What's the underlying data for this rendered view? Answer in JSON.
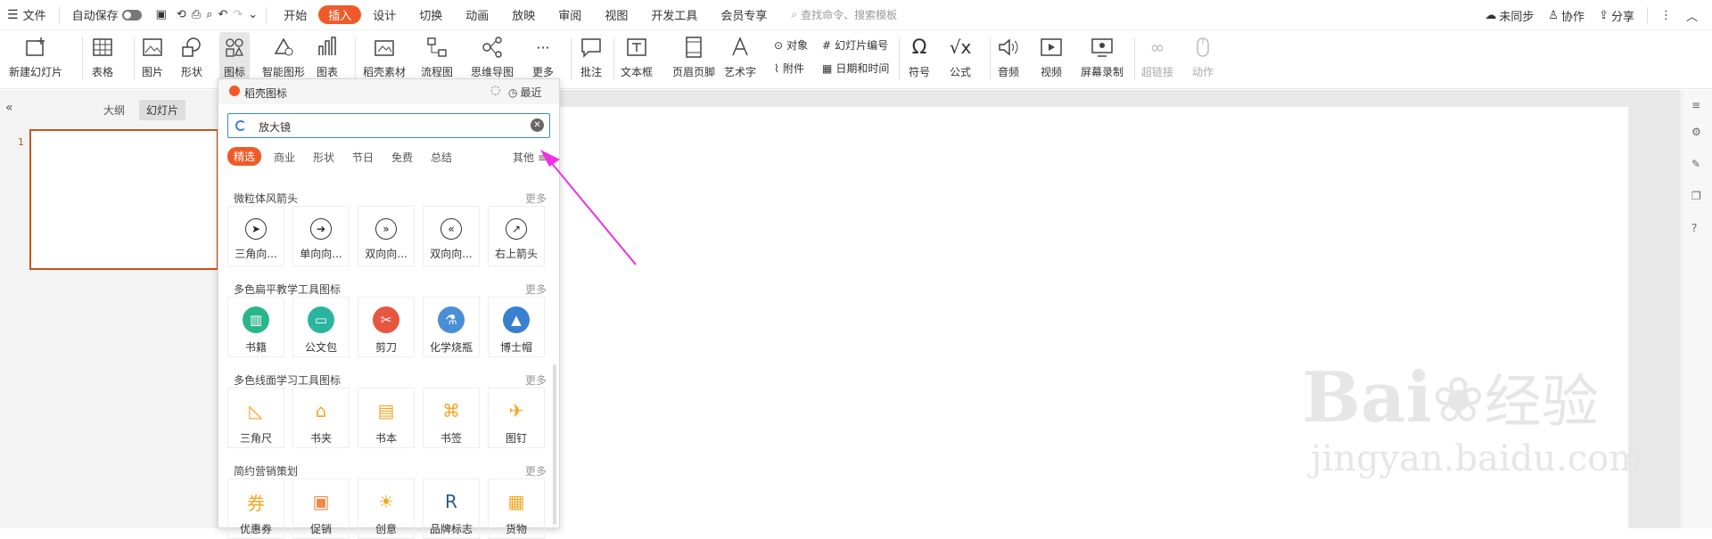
{
  "menubar": {
    "file": "文件",
    "autosave": "自动保存",
    "tabs": [
      "开始",
      "插入",
      "设计",
      "切换",
      "动画",
      "放映",
      "审阅",
      "视图",
      "开发工具",
      "会员专享"
    ],
    "search_placeholder": "查找命令、搜索模板",
    "unsynced": "未同步",
    "collab": "协作",
    "share": "分享"
  },
  "ribbon": {
    "new_slide": "新建幻灯片",
    "table": "表格",
    "picture": "图片",
    "shape": "形状",
    "icon": "图标",
    "smart": "智能图形",
    "chart": "图表",
    "material": "稻壳素材",
    "flow": "流程图",
    "mind": "思维导图",
    "more": "更多",
    "comment": "批注",
    "textbox": "文本框",
    "header": "页眉页脚",
    "art": "艺术字",
    "object": "对象",
    "slideno": "幻灯片编号",
    "attach": "附件",
    "datetime": "日期和时间",
    "symbol": "符号",
    "formula": "公式",
    "audio": "音频",
    "video": "视频",
    "screenrec": "屏幕录制",
    "hyperlink": "超链接",
    "action": "动作"
  },
  "leftpane": {
    "outline": "大纲",
    "slides": "幻灯片",
    "slide_number": "1"
  },
  "panel": {
    "title": "稻壳图标",
    "recent": "最近",
    "search_value": "放大镜",
    "categories": [
      "精选",
      "商业",
      "形状",
      "节日",
      "免费",
      "总结"
    ],
    "other": "其他",
    "more": "更多",
    "sections": [
      {
        "title": "微粒体风箭头",
        "items": [
          {
            "label": "三角向...",
            "glyph": "➤"
          },
          {
            "label": "单向向...",
            "glyph": "➔"
          },
          {
            "label": "双向向...",
            "glyph": "»"
          },
          {
            "label": "双向向...",
            "glyph": "«"
          },
          {
            "label": "右上箭头",
            "glyph": "↗"
          }
        ]
      },
      {
        "title": "多色扁平教学工具图标",
        "items": [
          {
            "label": "书籍",
            "glyph": "▥",
            "color": "#2bb58a"
          },
          {
            "label": "公文包",
            "glyph": "▭",
            "color": "#2bb5a0"
          },
          {
            "label": "剪刀",
            "glyph": "✂",
            "color": "#e8553f"
          },
          {
            "label": "化学烧瓶",
            "glyph": "⚗",
            "color": "#4a8fd6"
          },
          {
            "label": "博士帽",
            "glyph": "▲",
            "color": "#3a7fd0"
          }
        ]
      },
      {
        "title": "多色线面学习工具图标",
        "items": [
          {
            "label": "三角尺",
            "glyph": "◺",
            "color": "#f5a623"
          },
          {
            "label": "书夹",
            "glyph": "⌂",
            "color": "#f5a623"
          },
          {
            "label": "书本",
            "glyph": "▤",
            "color": "#f5a623"
          },
          {
            "label": "书签",
            "glyph": "⌘",
            "color": "#f5a623"
          },
          {
            "label": "图钉",
            "glyph": "✈",
            "color": "#f5a623"
          }
        ]
      },
      {
        "title": "简约营销策划",
        "items": [
          {
            "label": "优惠券",
            "glyph": "券",
            "color": "#f5a623"
          },
          {
            "label": "促销",
            "glyph": "▣",
            "color": "#f08a4b"
          },
          {
            "label": "创意",
            "glyph": "☀",
            "color": "#f5a623"
          },
          {
            "label": "品牌标志",
            "glyph": "R",
            "color": "#2d5a8c"
          },
          {
            "label": "货物",
            "glyph": "▦",
            "color": "#f5a623"
          }
        ]
      }
    ]
  },
  "watermark": {
    "brand": "Bai",
    "brand2": "经验",
    "url": "jingyan.baidu.com"
  },
  "colors": {
    "accent": "#f05a28",
    "arrow": "#f030e0",
    "slide_border": "#c8551c"
  }
}
